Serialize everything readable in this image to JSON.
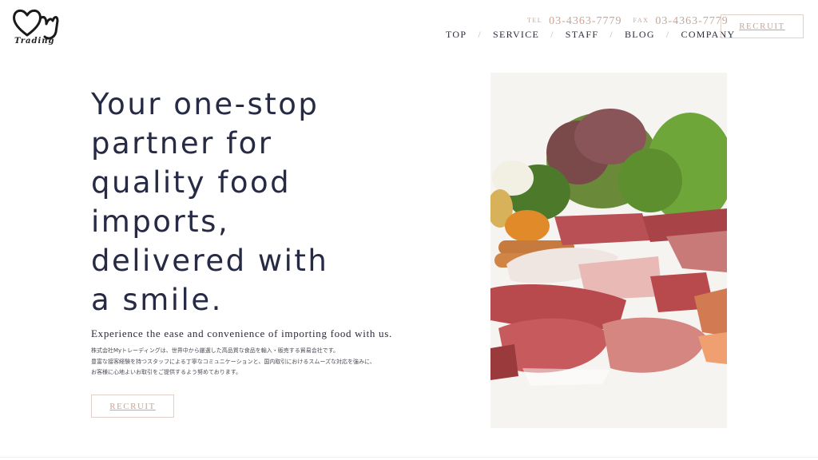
{
  "brand": {
    "logo_text": "Trading"
  },
  "contact": {
    "tel_label": "TEL",
    "tel": "03-4363-7779",
    "fax_label": "FAX",
    "fax": "03-4363-7779"
  },
  "nav": {
    "items": [
      {
        "label": "TOP"
      },
      {
        "label": "SERVICE"
      },
      {
        "label": "STAFF"
      },
      {
        "label": "BLOG"
      },
      {
        "label": "COMPANY"
      }
    ],
    "separator": "/"
  },
  "header_button": {
    "label": "RECRUIT"
  },
  "hero": {
    "title_lines": [
      "Your one-stop",
      "partner for",
      "quality food",
      "imports,",
      "delivered with",
      "a smile."
    ],
    "subtitle": "Experience the ease and convenience of importing food with us.",
    "description_lines": [
      "株式会社Myトレーディングは、世界中から厳選した高品質な食品を輸入・販売する貿易会社です。",
      "豊富な接客経験を持つスタッフによる丁寧なコミュニケーションと、国内取引におけるスムーズな対応を強みに、",
      "お客様に心地よいお取引をご提供するよう努めております。"
    ],
    "button_label": "RECRUIT"
  },
  "colors": {
    "accent": "#c9a595",
    "heading": "#262a44",
    "border": "#e0d2cb"
  },
  "icons": {
    "logo": "heart-my-logo-icon"
  },
  "image": {
    "subject": "assorted-meats-and-vegetables-photo"
  }
}
